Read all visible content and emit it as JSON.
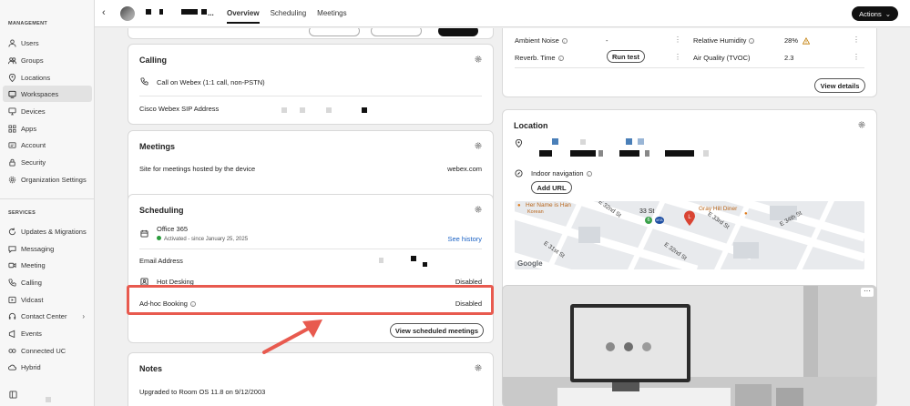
{
  "sidebar": {
    "management_label": "MANAGEMENT",
    "services_label": "SERVICES",
    "management_items": [
      {
        "label": "Users",
        "icon": "user-icon"
      },
      {
        "label": "Groups",
        "icon": "groups-icon"
      },
      {
        "label": "Locations",
        "icon": "location-pin-icon"
      },
      {
        "label": "Workspaces",
        "icon": "workspace-icon",
        "active": true
      },
      {
        "label": "Devices",
        "icon": "devices-icon"
      },
      {
        "label": "Apps",
        "icon": "apps-icon"
      },
      {
        "label": "Account",
        "icon": "account-icon"
      },
      {
        "label": "Security",
        "icon": "lock-icon"
      },
      {
        "label": "Organization Settings",
        "icon": "gear-icon"
      }
    ],
    "services_items": [
      {
        "label": "Updates & Migrations",
        "icon": "refresh-icon"
      },
      {
        "label": "Messaging",
        "icon": "chat-icon"
      },
      {
        "label": "Meeting",
        "icon": "meeting-icon"
      },
      {
        "label": "Calling",
        "icon": "phone-icon"
      },
      {
        "label": "Vidcast",
        "icon": "vidcast-icon"
      },
      {
        "label": "Contact Center",
        "icon": "headset-icon"
      },
      {
        "label": "Events",
        "icon": "events-icon"
      },
      {
        "label": "Connected UC",
        "icon": "connected-uc-icon"
      },
      {
        "label": "Hybrid",
        "icon": "cloud-icon"
      }
    ]
  },
  "header": {
    "title_suffix": "...",
    "tabs": [
      "Overview",
      "Scheduling",
      "Meetings"
    ],
    "actions_label": "Actions"
  },
  "calling": {
    "title": "Calling",
    "call_row": "Call on Webex (1:1 call, non-PSTN)",
    "sip_label": "Cisco Webex SIP Address"
  },
  "meetings": {
    "title": "Meetings",
    "site_label": "Site for meetings hosted by the device",
    "site_value": "webex.com"
  },
  "scheduling": {
    "title": "Scheduling",
    "provider": "Office 365",
    "status": "Activated",
    "since": "- since January 25, 2025",
    "see_history": "See history",
    "email_label": "Email Address",
    "hot_desking_label": "Hot Desking",
    "hot_desking_value": "Disabled",
    "adhoc_label": "Ad-hoc Booking",
    "adhoc_value": "Disabled",
    "view_meetings_button": "View scheduled meetings"
  },
  "notes": {
    "title": "Notes",
    "text": "Upgraded to Room OS 11.8 on 9/12/2003"
  },
  "sensors": {
    "ambient_noise_label": "Ambient Noise",
    "ambient_noise_value": "-",
    "reverb_label": "Reverb. Time",
    "run_test_button": "Run test",
    "humidity_label": "Relative Humidity",
    "humidity_value": "28%",
    "air_quality_label": "Air Quality (TVOC)",
    "air_quality_value": "2.3",
    "view_details_button": "View details"
  },
  "location": {
    "title": "Location",
    "indoor_nav_label": "Indoor navigation",
    "add_url_button": "Add URL",
    "map_labels": {
      "restaurant": "Her Name is Han",
      "restaurant_type": "Korean",
      "street_33": "33 St",
      "e32_a": "E 32nd St",
      "e33": "E 33rd St",
      "e32_b": "E 32nd St",
      "e31": "E 31st St",
      "e34": "E 34th St",
      "diner": "Gray Hill Diner",
      "subway_6": "6",
      "subway_mta": "MTA",
      "brand": "Google"
    }
  }
}
